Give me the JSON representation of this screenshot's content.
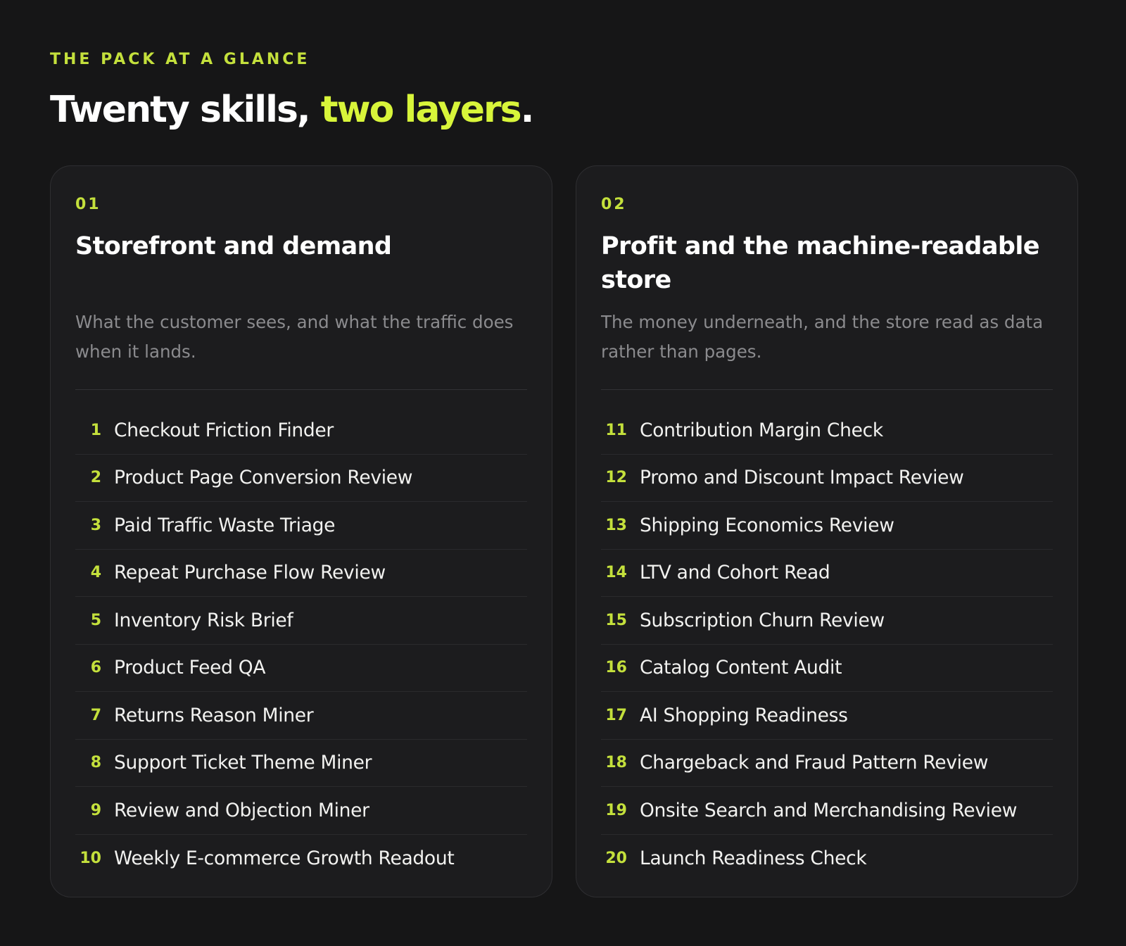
{
  "header": {
    "eyebrow": "THE PACK AT A GLANCE",
    "headline_start": "Twenty skills, ",
    "headline_accent": "two layers",
    "headline_end": "."
  },
  "colors": {
    "background": "#161617",
    "card": "#1c1c1e",
    "accent": "#d8f53a",
    "text": "#f2f2f0",
    "muted": "#8b8b8e"
  },
  "cards": [
    {
      "num": "01",
      "title": "Storefront and demand",
      "description": "What the customer sees, and what the traffic does when it lands.",
      "items": [
        {
          "num": "1",
          "label": "Checkout Friction Finder"
        },
        {
          "num": "2",
          "label": "Product Page Conversion Review"
        },
        {
          "num": "3",
          "label": "Paid Traffic Waste Triage"
        },
        {
          "num": "4",
          "label": "Repeat Purchase Flow Review"
        },
        {
          "num": "5",
          "label": "Inventory Risk Brief"
        },
        {
          "num": "6",
          "label": "Product Feed QA"
        },
        {
          "num": "7",
          "label": "Returns Reason Miner"
        },
        {
          "num": "8",
          "label": "Support Ticket Theme Miner"
        },
        {
          "num": "9",
          "label": "Review and Objection Miner"
        },
        {
          "num": "10",
          "label": "Weekly E-commerce Growth Readout"
        }
      ]
    },
    {
      "num": "02",
      "title": "Profit and the machine-readable store",
      "description": "The money underneath, and the store read as data rather than pages.",
      "items": [
        {
          "num": "11",
          "label": "Contribution Margin Check"
        },
        {
          "num": "12",
          "label": "Promo and Discount Impact Review"
        },
        {
          "num": "13",
          "label": "Shipping Economics Review"
        },
        {
          "num": "14",
          "label": "LTV and Cohort Read"
        },
        {
          "num": "15",
          "label": "Subscription Churn Review"
        },
        {
          "num": "16",
          "label": "Catalog Content Audit"
        },
        {
          "num": "17",
          "label": "AI Shopping Readiness"
        },
        {
          "num": "18",
          "label": "Chargeback and Fraud Pattern Review"
        },
        {
          "num": "19",
          "label": "Onsite Search and Merchandising Review"
        },
        {
          "num": "20",
          "label": "Launch Readiness Check"
        }
      ]
    }
  ]
}
